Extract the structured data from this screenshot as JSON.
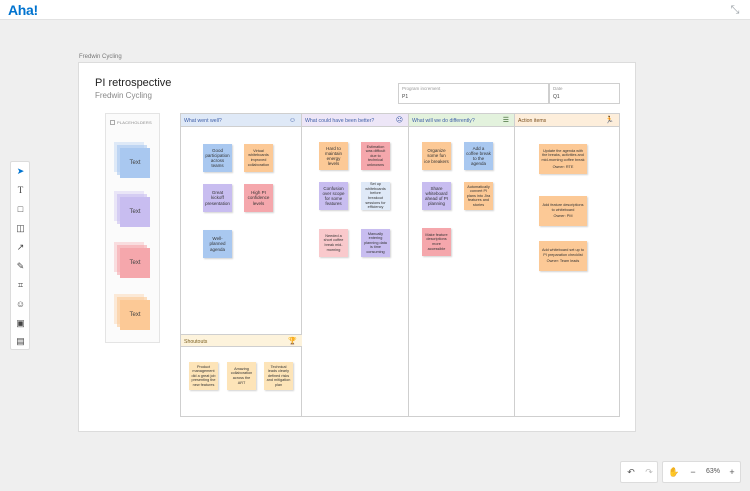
{
  "app": {
    "logo": "Aha!",
    "collapse_icon": "collapse-arrows-icon"
  },
  "breadcrumb": "Fredwin Cycling",
  "board": {
    "title": "PI retrospective",
    "subtitle": "Fredwin Cycling",
    "program_increment": {
      "label": "Program increment",
      "value": "P1"
    },
    "date": {
      "label": "Date",
      "value": "Q1"
    }
  },
  "placeholders": {
    "header": "PLACEHOLDERS",
    "items": [
      {
        "label": "Text",
        "color": "#a9c8f0"
      },
      {
        "label": "Text",
        "color": "#c8bdf0"
      },
      {
        "label": "Text",
        "color": "#f5a7ac"
      },
      {
        "label": "Text",
        "color": "#fcc996"
      }
    ]
  },
  "columns": {
    "went_well": {
      "title": "What went well?",
      "icon": "smile-icon",
      "bg": "#dfe9f7"
    },
    "could_be_better": {
      "title": "What could have been better?",
      "icon": "neutral-face-icon",
      "bg": "#ede6f7"
    },
    "do_differently": {
      "title": "What will we do differently?",
      "icon": "signpost-icon",
      "bg": "#e3f2dd"
    },
    "action_items": {
      "title": "Action items",
      "icon": "runner-icon",
      "bg": "#fdeedb"
    },
    "shoutouts": {
      "title": "Shoutouts",
      "icon": "trophy-icon"
    }
  },
  "notes": {
    "n1": "Good participation across teams",
    "n2": "Virtual whiteboards improved collaboration",
    "n3": "Great kickoff presentation",
    "n4": "High PI confidence levels",
    "n5": "Well-planned agenda",
    "n6": "Hard to maintain energy levels",
    "n7": "Estimation was difficult due to technical unknowns",
    "n8": "Confusion over scope for some features",
    "n9": "Set up whiteboards before breakout sessions for efficiency",
    "n10": "Needed a short coffee break mid-morning",
    "n11": "Manually entering planning data is time consuming",
    "n12": "Organize some fun ice breakers",
    "n13": "Add a coffee break to the agenda",
    "n14": "Share whiteboard ahead of PI planning",
    "n15": "Automatically convert PI plans into Jira features and stories",
    "n16": "Make feature descriptions more accessible",
    "n17": "Update the agenda with the breaks, activities and mid-morning coffee break",
    "n17_owner": "Owner: RTE",
    "n18": "Add feature descriptions to whiteboard",
    "n18_owner": "Owner: PM",
    "n19": "Add whiteboard set up to PI preparation checklist",
    "n19_owner": "Owner: Team leads",
    "s1": "Product management did a great job presenting the new features",
    "s2": "Amazing collaboration across the ART",
    "s3": "Technical leads clearly defined risks and mitigation plan"
  },
  "colors": {
    "blue": "#a9c8f0",
    "purple": "#c8bdf0",
    "pink": "#f5a7ac",
    "orange": "#fcc996",
    "yellow": "#fde4b8"
  },
  "tools": [
    "pointer-icon",
    "text-icon",
    "shape-icon",
    "sticky-note-icon",
    "connector-icon",
    "pen-icon",
    "frame-icon",
    "emoji-icon",
    "image-icon",
    "template-icon"
  ],
  "zoom": {
    "level": "63%",
    "undo_icon": "undo-icon",
    "redo_icon": "redo-icon",
    "hand_icon": "hand-icon",
    "zoom_out_icon": "minus-icon",
    "zoom_in_icon": "plus-icon"
  }
}
